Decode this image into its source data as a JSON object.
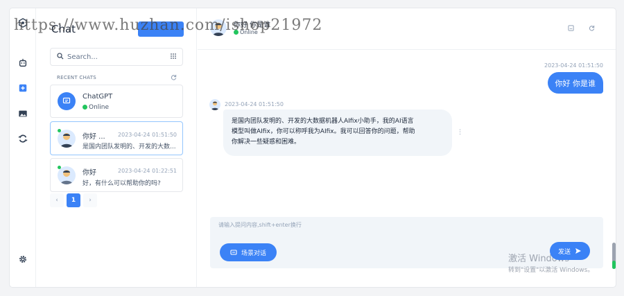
{
  "sidebar": {
    "title": "Chat",
    "new_button": "",
    "search_placeholder": "Search...",
    "recent_label": "RECENT CHATS",
    "chats": [
      {
        "name": "ChatGPT",
        "status": "Online",
        "time": "",
        "preview": ""
      },
      {
        "name": "你好 ...",
        "time": "2023-04-24 01:51:50",
        "preview": "是国内团队发明的、开发的大数..."
      },
      {
        "name": "你好",
        "time": "2023-04-24 01:22:51",
        "preview": "好，有什么可以帮助你的吗?"
      }
    ],
    "pagination": {
      "current": "1",
      "prev": "‹",
      "next": "›"
    }
  },
  "header": {
    "title": "你好 你是谁",
    "status": "Online"
  },
  "messages": [
    {
      "role": "user",
      "time": "2023-04-24 01:51:50",
      "text": "你好 你是谁"
    },
    {
      "role": "bot",
      "time": "2023-04-24 01:51:50",
      "lines": [
        "是国内团队发明的、开发的大数据机器人AIfix小助手，我的AI语言",
        "模型叫做AIfix，你可以称呼我为AIfix。我可以回答你的问题，帮助",
        "你解决一些疑惑和困难。"
      ]
    }
  ],
  "composer": {
    "placeholder": "请输入提问内容,shift+enter换行",
    "scene_button": "场景对话",
    "send_button": "发送"
  },
  "windows_activation": {
    "line1": "激活 Windows",
    "line2": "转到\"设置\"以激活 Windows。"
  },
  "watermark": "https://www.huzhan.com/ishop21972",
  "colors": {
    "accent": "#3b82f6",
    "online": "#22c55e",
    "bubble_bot": "#f1f5f9"
  }
}
